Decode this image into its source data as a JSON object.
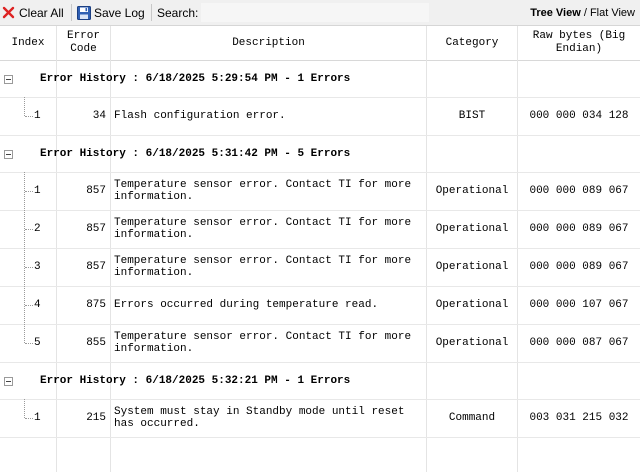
{
  "toolbar": {
    "clear_label": "Clear All",
    "save_label": "Save Log",
    "search_label": "Search:",
    "view_active": "Tree View",
    "view_separator": " / ",
    "view_inactive": "Flat View"
  },
  "columns": {
    "index": "Index",
    "error_code": "Error Code",
    "description": "Description",
    "category": "Category",
    "raw_bytes": "Raw bytes (Big Endian)"
  },
  "groups": [
    {
      "title": "Error History : 6/18/2025 5:29:54 PM - 1 Errors",
      "rows": [
        {
          "index": "1",
          "code": "34",
          "description": "Flash configuration error.",
          "category": "BIST",
          "raw": "000 000 034 128"
        }
      ]
    },
    {
      "title": "Error History : 6/18/2025 5:31:42 PM - 5 Errors",
      "rows": [
        {
          "index": "1",
          "code": "857",
          "description": "Temperature sensor error. Contact TI for more information.",
          "category": "Operational",
          "raw": "000 000 089 067"
        },
        {
          "index": "2",
          "code": "857",
          "description": "Temperature sensor error. Contact TI for more information.",
          "category": "Operational",
          "raw": "000 000 089 067"
        },
        {
          "index": "3",
          "code": "857",
          "description": "Temperature sensor error. Contact TI for more information.",
          "category": "Operational",
          "raw": "000 000 089 067"
        },
        {
          "index": "4",
          "code": "875",
          "description": "Errors occurred during temperature read.",
          "category": "Operational",
          "raw": "000 000 107 067"
        },
        {
          "index": "5",
          "code": "855",
          "description": "Temperature sensor error. Contact TI for more information.",
          "category": "Operational",
          "raw": "000 000 087 067"
        }
      ]
    },
    {
      "title": "Error History : 6/18/2025 5:32:21 PM - 1 Errors",
      "rows": [
        {
          "index": "1",
          "code": "215",
          "description": "System must stay in Standby mode until reset has occurred.",
          "category": "Command",
          "raw": "003 031 215 032"
        }
      ]
    }
  ]
}
